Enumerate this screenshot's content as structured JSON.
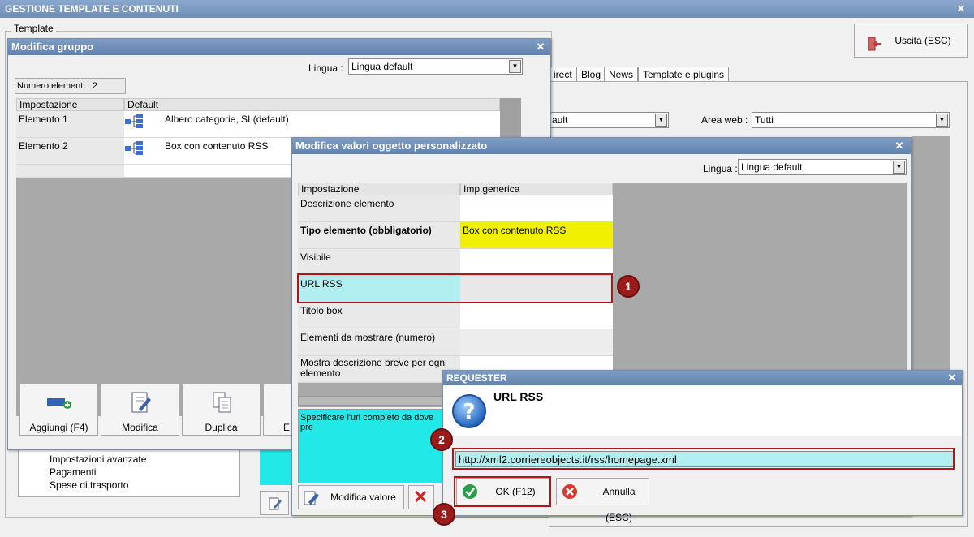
{
  "app": {
    "title": "GESTIONE TEMPLATE E CONTENUTI",
    "template_group_label": "Template",
    "exit_button": "Uscita (ESC)",
    "tabs": [
      "irect",
      "Blog",
      "News",
      "Template e plugins"
    ],
    "filter_value": "ault",
    "area_web_label": "Area web :",
    "area_web_value": "Tutti",
    "tree_items": [
      "Impostazioni avanzate",
      "Pagamenti",
      "Spese di trasporto"
    ]
  },
  "gruppo": {
    "title": "Modifica gruppo",
    "lingua_label": "Lingua :",
    "lingua_value": "Lingua default",
    "count_label": "Numero elementi : 2",
    "columns": [
      "Impostazione",
      "Default"
    ],
    "rows": [
      {
        "name": "Elemento 1",
        "value": "Albero categorie, SI (default)"
      },
      {
        "name": "Elemento 2",
        "value": "Box con contenuto RSS"
      }
    ],
    "buttons": [
      "Aggiungi (F4)",
      "Modifica",
      "Duplica",
      "E"
    ]
  },
  "oggetto": {
    "title": "Modifica valori oggetto personalizzato",
    "lingua_label": "Lingua :",
    "lingua_value": "Lingua default",
    "columns": [
      "Impostazione",
      "Imp.generica"
    ],
    "rows": [
      {
        "name": "Descrizione elemento",
        "value": ""
      },
      {
        "name": "Tipo elemento (obbligatorio)",
        "value": "Box con contenuto RSS"
      },
      {
        "name": "Visibile",
        "value": ""
      },
      {
        "name": "URL RSS",
        "value": ""
      },
      {
        "name": "Titolo box",
        "value": ""
      },
      {
        "name": "Elementi da mostrare (numero)",
        "value": ""
      },
      {
        "name": "Mostra descrizione breve per ogni elemento",
        "value": ""
      }
    ],
    "description": "Specificare l'url completo da dove pre",
    "modify_button": "Modifica valore"
  },
  "requester": {
    "title": "REQUESTER",
    "heading": "URL RSS",
    "input_value": "http://xml2.corriereobjects.it/rss/homepage.xml",
    "ok_button": "OK (F12)",
    "cancel_button": "Annulla (ESC)"
  },
  "annotations": [
    "1",
    "2",
    "3"
  ],
  "colors": {
    "title_bar": "#7592bb",
    "highlight_cyan": "#b0eef0",
    "yellow": "#f0f000",
    "annotation_red": "#b21616"
  }
}
